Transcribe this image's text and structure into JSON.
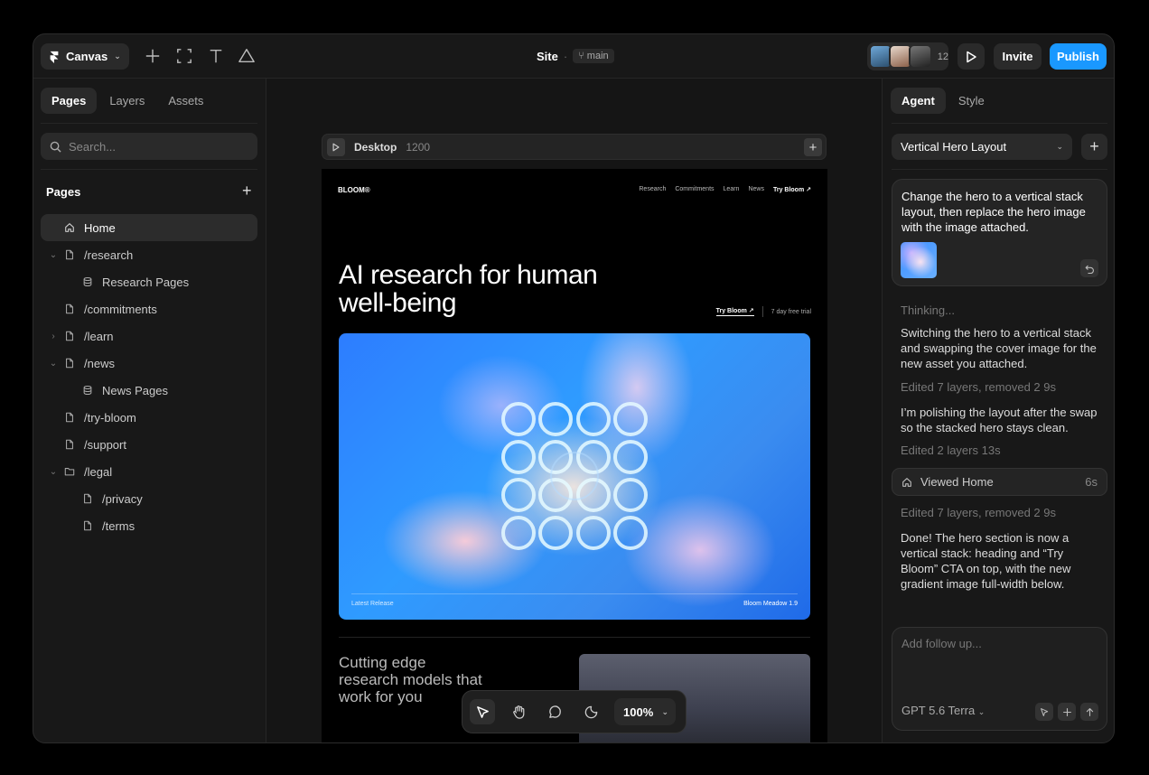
{
  "topbar": {
    "app_label": "Canvas",
    "site_name": "Site",
    "branch": "main",
    "collaborator_count": "12",
    "invite_label": "Invite",
    "publish_label": "Publish",
    "accent_color": "#1a98ff"
  },
  "left": {
    "tabs": [
      "Pages",
      "Layers",
      "Assets"
    ],
    "search_placeholder": "Search...",
    "pages_heading": "Pages",
    "pages": [
      {
        "label": "Home",
        "icon": "home-icon",
        "indent": 0,
        "chevron": "",
        "active": true
      },
      {
        "label": "/research",
        "icon": "page-icon",
        "indent": 0,
        "chevron": "v"
      },
      {
        "label": "Research Pages",
        "icon": "database-icon",
        "indent": 1,
        "chevron": ""
      },
      {
        "label": "/commitments",
        "icon": "page-icon",
        "indent": 0,
        "chevron": ""
      },
      {
        "label": "/learn",
        "icon": "page-icon",
        "indent": 0,
        "chevron": ">"
      },
      {
        "label": "/news",
        "icon": "page-icon",
        "indent": 0,
        "chevron": "v"
      },
      {
        "label": "News Pages",
        "icon": "database-icon",
        "indent": 1,
        "chevron": ""
      },
      {
        "label": "/try-bloom",
        "icon": "page-icon",
        "indent": 0,
        "chevron": ""
      },
      {
        "label": "/support",
        "icon": "page-icon",
        "indent": 0,
        "chevron": ""
      },
      {
        "label": "/legal",
        "icon": "folder-icon",
        "indent": 0,
        "chevron": "v"
      },
      {
        "label": "/privacy",
        "icon": "page-icon",
        "indent": 1,
        "chevron": ""
      },
      {
        "label": "/terms",
        "icon": "page-icon",
        "indent": 1,
        "chevron": ""
      }
    ]
  },
  "canvas": {
    "frame_name": "Desktop",
    "frame_width": "1200",
    "zoom": "100%",
    "site": {
      "brand": "BLOOM®",
      "nav": [
        "Research",
        "Commitments",
        "Learn",
        "News"
      ],
      "nav_cta": "Try Bloom ↗",
      "hero_title": "AI research for human well-being",
      "hero_cta": "Try Bloom ↗",
      "hero_trial": "7 day free trial",
      "release_label": "Latest Release",
      "release_name": "Bloom Meadow 1.9",
      "section_title": "Cutting edge research models that work for you"
    }
  },
  "right": {
    "tabs": [
      "Agent",
      "Style"
    ],
    "layout_select": "Vertical Hero Layout",
    "user_message": "Change the hero to a vertical stack layout, then replace the hero image with the image attached.",
    "thinking": "Thinking...",
    "msg1": "Switching the hero to a vertical stack and swapping the cover image for the new asset you attached.",
    "meta1": "Edited 7 layers, removed 2",
    "meta1_time": "9s",
    "msg2": "I’m polishing the layout after the swap so the stacked hero stays clean.",
    "meta2": "Edited 2 layers",
    "meta2_time": "13s",
    "viewed_label": "Viewed Home",
    "viewed_time": "6s",
    "meta3": "Edited 7 layers, removed 2",
    "meta3_time": "9s",
    "msg3": "Done! The hero section is now a vertical stack: heading and “Try Bloom” CTA on top, with the new gradient image full-width below.",
    "composer_placeholder": "Add follow up...",
    "model": "GPT 5.6 Terra"
  }
}
